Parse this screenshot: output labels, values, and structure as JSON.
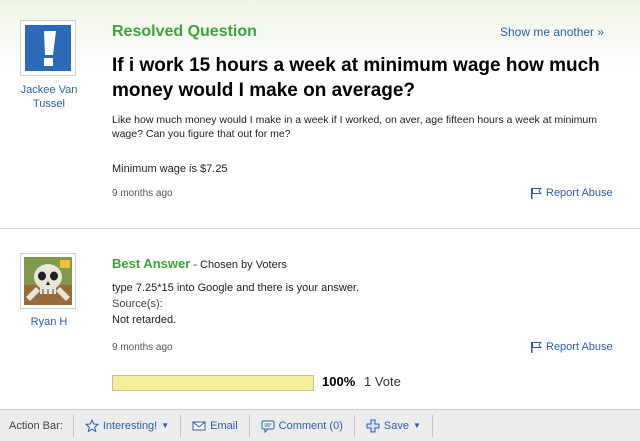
{
  "question": {
    "status": "Resolved Question",
    "show_another": "Show me another »",
    "asker_name": "Jackee Van Tussel",
    "title": "If i work 15 hours a week at minimum wage how much money would I make on average?",
    "body": "Like how much money would I make in a week if I worked, on aver, age fifteen hours a week at minimum wage? Can you figure that out for me?",
    "wage_line": "Minimum wage is $7.25",
    "time": "9 months ago",
    "report": "Report Abuse"
  },
  "answer": {
    "answerer_name": "Ryan H",
    "best_label": "Best Answer",
    "chosen_by": " - Chosen by Voters",
    "body": "type 7.25*15 into Google and there is your answer.",
    "source_label": "Source(s):",
    "source": "Not retarded.",
    "time": "9 months ago",
    "report": "Report Abuse",
    "vote_percent": "100%",
    "vote_fraction": 1.0,
    "vote_count": "1 Vote"
  },
  "action_bar": {
    "label": "Action Bar:",
    "interesting": "Interesting!",
    "email": "Email",
    "comment": "Comment (0)",
    "save": "Save"
  },
  "colors": {
    "green_heading": "#3aa53a",
    "link_blue": "#2f5ea8",
    "avatar_blue": "#2a6ab8",
    "vote_fill": "#f4ee9d"
  },
  "icons": {
    "asker_avatar": "exclamation-icon",
    "answerer_avatar": "skull-icon",
    "report": "flag-icon",
    "interesting": "star-icon",
    "email": "envelope-icon",
    "comment": "speech-bubble-icon",
    "save": "plus-icon"
  }
}
